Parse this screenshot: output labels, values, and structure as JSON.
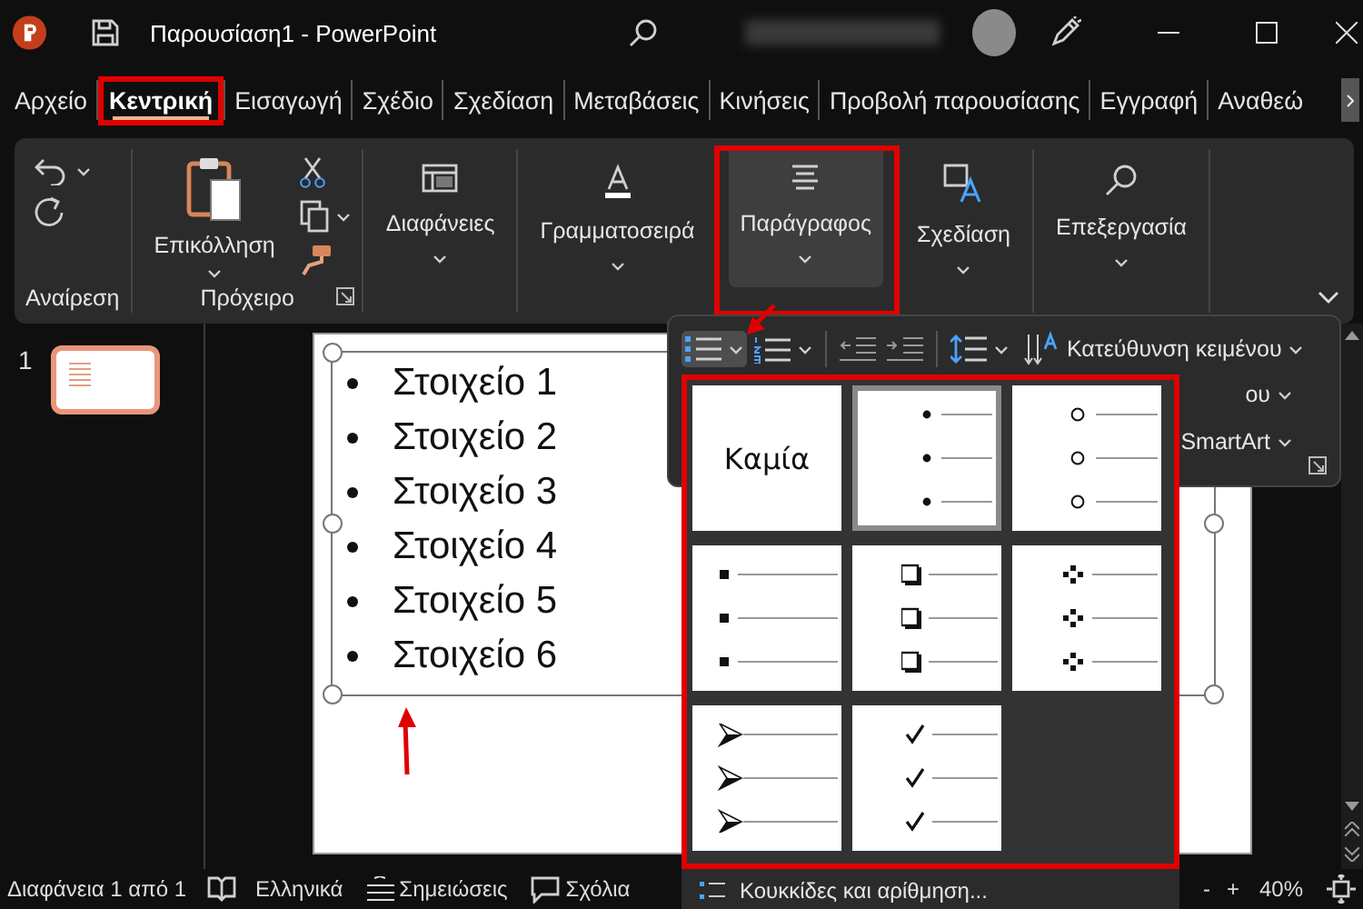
{
  "window": {
    "title": "Παρουσίαση1  -  PowerPoint"
  },
  "ribbon_tabs": [
    {
      "label": "Αρχείο",
      "selected": false,
      "highlighted": false
    },
    {
      "label": "Κεντρική",
      "selected": true,
      "highlighted": true
    },
    {
      "label": "Εισαγωγή",
      "selected": false,
      "highlighted": false
    },
    {
      "label": "Σχέδιο",
      "selected": false,
      "highlighted": false
    },
    {
      "label": "Σχεδίαση",
      "selected": false,
      "highlighted": false
    },
    {
      "label": "Μεταβάσεις",
      "selected": false,
      "highlighted": false
    },
    {
      "label": "Κινήσεις",
      "selected": false,
      "highlighted": false
    },
    {
      "label": "Προβολή παρουσίασης",
      "selected": false,
      "highlighted": false
    },
    {
      "label": "Εγγραφή",
      "selected": false,
      "highlighted": false
    },
    {
      "label": "Αναθεώ",
      "selected": false,
      "highlighted": false
    }
  ],
  "ribbon_groups": [
    {
      "kind": "undo",
      "label": "Αναίρεση",
      "highlighted": false
    },
    {
      "kind": "clipboard",
      "label": "Πρόχειρο",
      "button": "Επικόλληση",
      "highlighted": false
    },
    {
      "kind": "slides",
      "button": "Διαφάνειες",
      "expanded": false,
      "highlighted": false
    },
    {
      "kind": "font",
      "button": "Γραμματοσειρά",
      "expanded": false,
      "highlighted": false
    },
    {
      "kind": "paragraph",
      "button": "Παράγραφος",
      "expanded": true,
      "highlighted": true
    },
    {
      "kind": "designer",
      "button": "Σχεδίαση",
      "expanded": false,
      "highlighted": false
    },
    {
      "kind": "editing",
      "button": "Επεξεργασία",
      "expanded": false,
      "highlighted": false
    }
  ],
  "slide_thumbnails": [
    {
      "number": "1",
      "selected": true
    }
  ],
  "slide": {
    "bullets": [
      "Στοιχείο 1",
      "Στοιχείο 2",
      "Στοιχείο 3",
      "Στοιχείο 4",
      "Στοιχείο 5",
      "Στοιχείο 6"
    ]
  },
  "paragraph_panel": {
    "buttons": [
      {
        "kind": "bullets",
        "pressed": true
      },
      {
        "kind": "numbering",
        "pressed": false
      },
      {
        "kind": "decrease_indent",
        "pressed": false
      },
      {
        "kind": "increase_indent",
        "pressed": false
      },
      {
        "kind": "line_spacing",
        "pressed": false
      }
    ],
    "text_direction": "Κατεύθυνση κειμένου",
    "align_text": "ου",
    "smartart": "SmartArt"
  },
  "bullet_gallery": {
    "highlighted": true,
    "options": [
      {
        "kind": "none",
        "label": "Καμία",
        "selected": false
      },
      {
        "kind": "dot",
        "selected": true
      },
      {
        "kind": "circle",
        "selected": false
      },
      {
        "kind": "square",
        "selected": false
      },
      {
        "kind": "box",
        "selected": false
      },
      {
        "kind": "diamond",
        "selected": false
      },
      {
        "kind": "arrow",
        "selected": false
      },
      {
        "kind": "check",
        "selected": false
      }
    ],
    "menu_item": "Κουκκίδες και αρίθμηση..."
  },
  "status_bar": {
    "slide_info": "Διαφάνεια 1 από 1",
    "language": "Ελληνικά",
    "notes": "Σημειώσεις",
    "comments": "Σχόλια",
    "zoom_out": "-",
    "zoom_in": "+",
    "zoom": "40%"
  }
}
